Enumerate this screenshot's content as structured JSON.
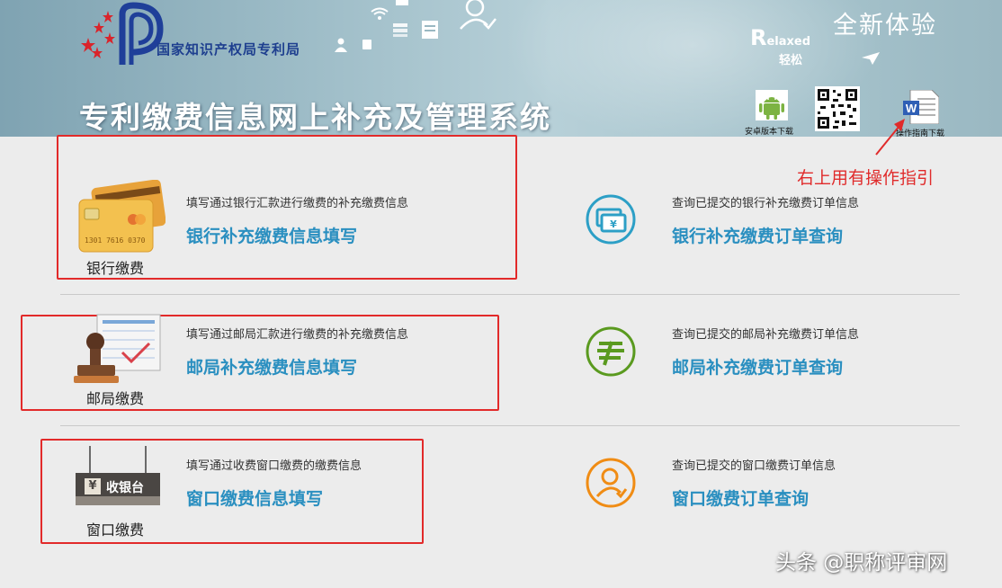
{
  "header": {
    "org_name": "国家知识产权局专利局",
    "system_title": "专利缴费信息网上补充及管理系统",
    "slogan": "全新体验",
    "relaxed_first": "R",
    "relaxed_rest": "elaxed",
    "relaxed_cn": "轻松",
    "downloads": [
      {
        "label": "安卓版本下载",
        "icon": "android-icon"
      },
      {
        "label": "",
        "icon": "qr-code-icon"
      },
      {
        "label": "操作指南下载",
        "icon": "word-document-icon"
      }
    ]
  },
  "annotation": "右上用有操作指引",
  "rows": [
    {
      "category": "银行缴费",
      "category_icon": "bank-card-icon",
      "fill_desc": "填写通过银行汇款进行缴费的补充缴费信息",
      "fill_link": "银行补充缴费信息填写",
      "query_icon": "bank-query-icon",
      "query_desc": "查询已提交的银行补充缴费订单信息",
      "query_link": "银行补充缴费订单查询"
    },
    {
      "category": "邮局缴费",
      "category_icon": "stamp-icon",
      "fill_desc": "填写通过邮局汇款进行缴费的补充缴费信息",
      "fill_link": "邮局补充缴费信息填写",
      "query_icon": "post-office-icon",
      "query_desc": "查询已提交的邮局补充缴费订单信息",
      "query_link": "邮局补充缴费订单查询"
    },
    {
      "category": "窗口缴费",
      "category_icon": "cashier-sign-icon",
      "cashier_sign_text": "收银台",
      "cashier_yen": "¥",
      "fill_desc": "填写通过收费窗口缴费的缴费信息",
      "fill_link": "窗口缴费信息填写",
      "query_icon": "user-query-icon",
      "query_desc": "查询已提交的窗口缴费订单信息",
      "query_link": "窗口缴费订单查询"
    }
  ],
  "watermark": "头条 @职称评审网",
  "colors": {
    "link": "#2a8fc0",
    "annotation": "#e02b2b",
    "bank_query": "#2c9fc6",
    "post_query": "#5a9a1f",
    "window_query": "#f08c14"
  }
}
